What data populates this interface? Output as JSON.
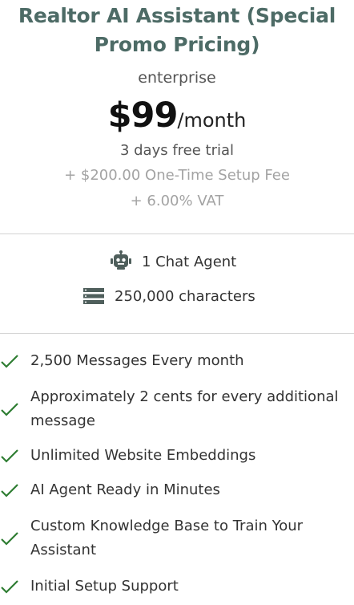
{
  "plan": {
    "title_line1": "Realtor AI Assistant (Special",
    "title_line2": "Promo Pricing)",
    "tier": "enterprise",
    "price": "$99",
    "period": "/month",
    "trial": "3 days free trial",
    "setup_fee": "+ $200.00 One-Time Setup Fee",
    "vat": "+ 6.00% VAT"
  },
  "specs": [
    {
      "icon": "robot-icon",
      "label": "1 Chat Agent"
    },
    {
      "icon": "server-stack-icon",
      "label": "250,000 characters"
    }
  ],
  "features": [
    {
      "label": "2,500 Messages Every month"
    },
    {
      "label": "Approximately 2 cents for every additional message"
    },
    {
      "label": "Unlimited Website Embeddings"
    },
    {
      "label": "AI Agent Ready in Minutes"
    },
    {
      "label": "Custom Knowledge Base to Train Your Assistant"
    },
    {
      "label": "Initial Setup Support"
    }
  ],
  "colors": {
    "title": "#4d6b66",
    "check": "#2e7d32",
    "muted": "#a3a3a3",
    "icon": "#4f5f5c"
  }
}
